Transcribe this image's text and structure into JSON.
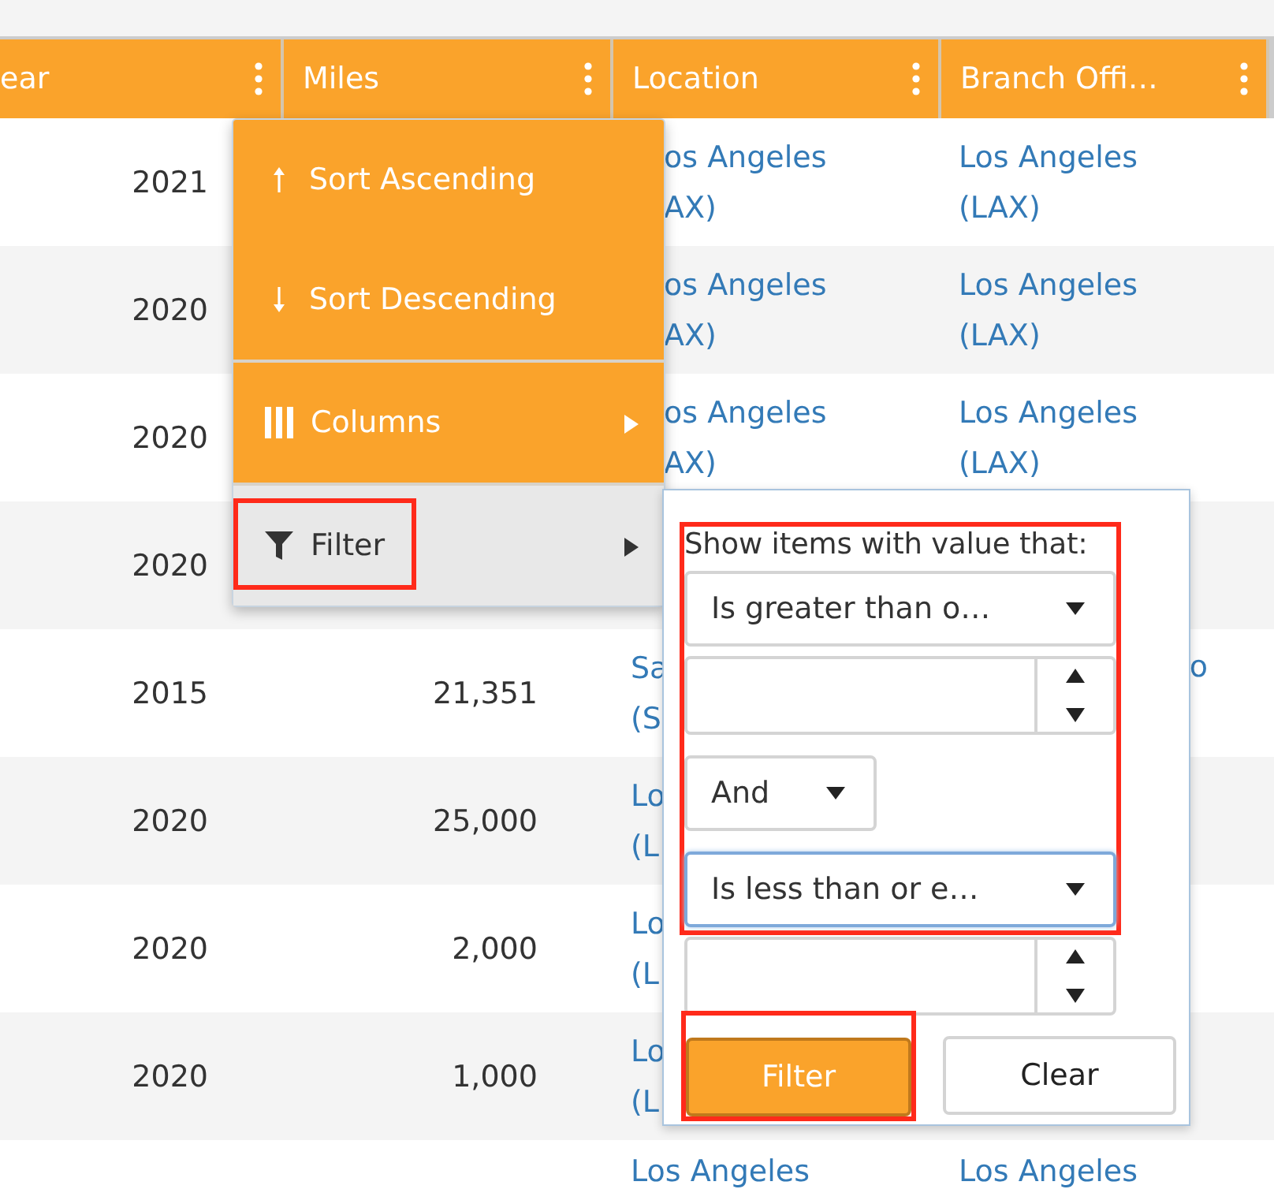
{
  "table": {
    "columns": [
      {
        "label": "ear"
      },
      {
        "label": "Miles"
      },
      {
        "label": "Location"
      },
      {
        "label": "Branch Offi…"
      }
    ],
    "rows": [
      {
        "year": "2021",
        "location": [
          "os Angeles",
          "AX)"
        ],
        "branch": [
          "Los Angeles",
          "(LAX)"
        ]
      },
      {
        "year": "2020",
        "location": [
          "os Angeles",
          "AX)"
        ],
        "branch": [
          "Los Angeles",
          "(LAX)"
        ]
      },
      {
        "year": "2020",
        "location": [
          "os Angeles",
          "AX)"
        ],
        "branch": [
          "Los Angeles",
          "(LAX)"
        ]
      },
      {
        "year": "2020"
      },
      {
        "year": "2015",
        "miles": "21,351",
        "location": [
          "Sa",
          "(S"
        ],
        "branch": [
          "o"
        ]
      },
      {
        "year": "2020",
        "miles": "25,000",
        "location": [
          "Lo",
          "(L"
        ]
      },
      {
        "year": "2020",
        "miles": "2,000",
        "location": [
          "Lo",
          "(L"
        ]
      },
      {
        "year": "2020",
        "miles": "1,000",
        "location": [
          "Lo",
          "(L"
        ]
      },
      {
        "location": [
          "Los Angeles"
        ],
        "branch": [
          "Los Angeles"
        ]
      }
    ]
  },
  "column_menu": {
    "items": [
      {
        "kind": "sort_ascending",
        "label": "Sort Ascending",
        "selected": false,
        "submenu": false,
        "divider_before": false,
        "highlighted": false
      },
      {
        "kind": "sort_descending",
        "label": "Sort Descending",
        "selected": false,
        "submenu": false,
        "divider_before": false,
        "highlighted": false
      },
      {
        "kind": "columns",
        "label": "Columns",
        "selected": false,
        "submenu": true,
        "divider_before": true,
        "highlighted": false
      },
      {
        "kind": "filter",
        "label": "Filter",
        "selected": true,
        "submenu": true,
        "divider_before": true,
        "highlighted": true
      }
    ]
  },
  "filter_popup": {
    "prompt": "Show items with value that:",
    "criteria_highlighted": true,
    "operator_1": "Is greater than o…",
    "logic": "And",
    "operator_2": "Is less than or e…",
    "operator_2_focused": true,
    "buttons": [
      {
        "label": "Filter",
        "primary": true,
        "highlighted": true
      },
      {
        "label": "Clear",
        "primary": false,
        "highlighted": false
      }
    ]
  }
}
